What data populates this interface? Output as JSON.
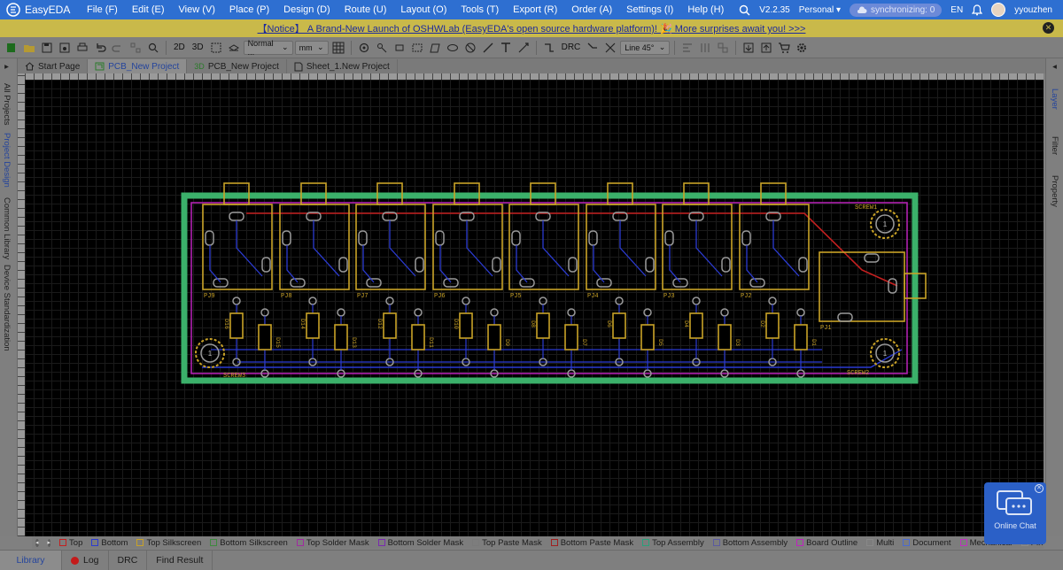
{
  "app": {
    "name": "EasyEDA",
    "version": "V2.2.35",
    "plan": "Personal",
    "sync": "synchronizing: 0",
    "lang": "EN",
    "user": "yyouzhen"
  },
  "menu": [
    "File (F)",
    "Edit (E)",
    "View (V)",
    "Place (P)",
    "Design (D)",
    "Route (U)",
    "Layout (O)",
    "Tools (T)",
    "Export (R)",
    "Order (A)",
    "Settings (I)",
    "Help (H)"
  ],
  "notice": {
    "text": "【Notice】 A Brand-New Launch of OSHWLab (EasyEDA's open source hardware platform)! 🎉 More surprises await you! >>>"
  },
  "toolbar": {
    "view2d": "2D",
    "view3d": "3D",
    "routing_mode": "Normal ...",
    "unit": "mm",
    "drc": "DRC",
    "line_mode": "Line 45°"
  },
  "tabs": [
    {
      "label": "Start Page",
      "icon": "home-icon"
    },
    {
      "label": "PCB_New Project",
      "icon": "pcb-icon"
    },
    {
      "label": "PCB_New Project",
      "icon": "3d-icon"
    },
    {
      "label": "Sheet_1.New Project",
      "icon": "sheet-icon"
    }
  ],
  "left_panel": [
    "All Projects",
    "Project Design",
    "Common Library",
    "Device Standardization"
  ],
  "right_panel": [
    "Layer",
    "Filter",
    "Property"
  ],
  "pcb": {
    "jack_labels": [
      "PJ9",
      "PJ8",
      "PJ7",
      "PJ6",
      "PJ5",
      "PJ4",
      "PJ3",
      "PJ2"
    ],
    "jack_main_label": "PJ1",
    "diode_labels": [
      "D16",
      "D15",
      "D14",
      "D13",
      "D12",
      "D11",
      "D10",
      "D9",
      "D8",
      "D7",
      "D6",
      "D5",
      "D4",
      "D3",
      "D2",
      "D1"
    ],
    "screw_labels": [
      "SCREW1",
      "SCREW2",
      "SCREW3"
    ],
    "screw_pad": "1",
    "colors": {
      "silk": "#c9a227",
      "top": "#c42020",
      "bottom": "#2b3bd1",
      "outline": "#c020c0",
      "assembly": "#3bb06a",
      "pad": "#9a9a9a"
    }
  },
  "layers": [
    {
      "name": "Top",
      "color": "#c42020"
    },
    {
      "name": "Bottom",
      "color": "#2b3bd1"
    },
    {
      "name": "Top Silkscreen",
      "color": "#c9a227"
    },
    {
      "name": "Bottom Silkscreen",
      "color": "#3f8a3f"
    },
    {
      "name": "Top Solder Mask",
      "color": "#a02aa0"
    },
    {
      "name": "Bottom Solder Mask",
      "color": "#7a2ab0"
    },
    {
      "name": "Top Paste Mask",
      "color": "#7a7a7a"
    },
    {
      "name": "Bottom Paste Mask",
      "color": "#a02020"
    },
    {
      "name": "Top Assembly",
      "color": "#2aa07a"
    },
    {
      "name": "Bottom Assembly",
      "color": "#5a5aa0"
    },
    {
      "name": "Board Outline",
      "color": "#c020c0"
    },
    {
      "name": "Multi",
      "color": "#888888"
    },
    {
      "name": "Document",
      "color": "#4a6ad0"
    },
    {
      "name": "Mechanical",
      "color": "#c030c0"
    },
    {
      "name": "Pin Soldering",
      "color": "#8a8a8a"
    }
  ],
  "bottom_tabs": [
    "Library",
    "Log",
    "DRC",
    "Find Result"
  ],
  "chat": {
    "label": "Online Chat"
  }
}
